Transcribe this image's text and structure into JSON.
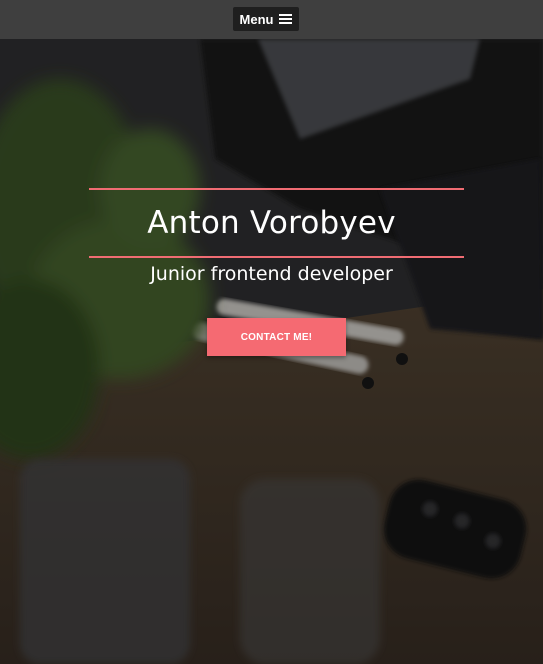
{
  "nav": {
    "menu_label": "Menu",
    "menu_icon": "hamburger-icon"
  },
  "hero": {
    "name": "Anton Vorobyev",
    "role": "Junior frontend developer",
    "cta_label": "CONTACT ME!",
    "background_image": "blurred desk with monitor, plant, pens and car key",
    "accent_color": "#f56a72",
    "divider_color": "#f06c73"
  }
}
